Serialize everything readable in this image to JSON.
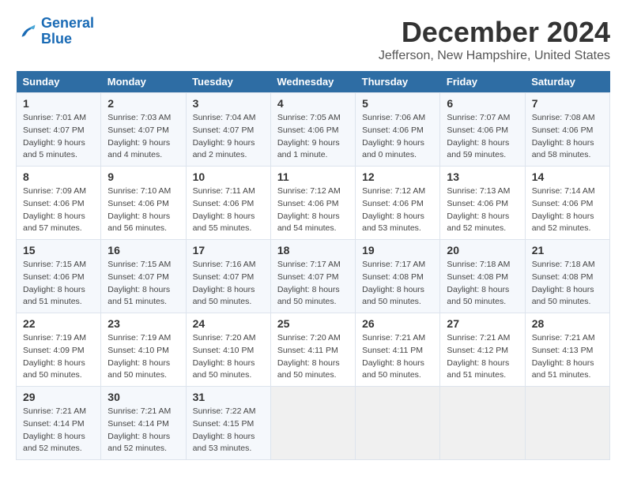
{
  "logo": {
    "line1": "General",
    "line2": "Blue"
  },
  "title": "December 2024",
  "location": "Jefferson, New Hampshire, United States",
  "days_of_week": [
    "Sunday",
    "Monday",
    "Tuesday",
    "Wednesday",
    "Thursday",
    "Friday",
    "Saturday"
  ],
  "weeks": [
    [
      {
        "day": "1",
        "info": "Sunrise: 7:01 AM\nSunset: 4:07 PM\nDaylight: 9 hours\nand 5 minutes."
      },
      {
        "day": "2",
        "info": "Sunrise: 7:03 AM\nSunset: 4:07 PM\nDaylight: 9 hours\nand 4 minutes."
      },
      {
        "day": "3",
        "info": "Sunrise: 7:04 AM\nSunset: 4:07 PM\nDaylight: 9 hours\nand 2 minutes."
      },
      {
        "day": "4",
        "info": "Sunrise: 7:05 AM\nSunset: 4:06 PM\nDaylight: 9 hours\nand 1 minute."
      },
      {
        "day": "5",
        "info": "Sunrise: 7:06 AM\nSunset: 4:06 PM\nDaylight: 9 hours\nand 0 minutes."
      },
      {
        "day": "6",
        "info": "Sunrise: 7:07 AM\nSunset: 4:06 PM\nDaylight: 8 hours\nand 59 minutes."
      },
      {
        "day": "7",
        "info": "Sunrise: 7:08 AM\nSunset: 4:06 PM\nDaylight: 8 hours\nand 58 minutes."
      }
    ],
    [
      {
        "day": "8",
        "info": "Sunrise: 7:09 AM\nSunset: 4:06 PM\nDaylight: 8 hours\nand 57 minutes."
      },
      {
        "day": "9",
        "info": "Sunrise: 7:10 AM\nSunset: 4:06 PM\nDaylight: 8 hours\nand 56 minutes."
      },
      {
        "day": "10",
        "info": "Sunrise: 7:11 AM\nSunset: 4:06 PM\nDaylight: 8 hours\nand 55 minutes."
      },
      {
        "day": "11",
        "info": "Sunrise: 7:12 AM\nSunset: 4:06 PM\nDaylight: 8 hours\nand 54 minutes."
      },
      {
        "day": "12",
        "info": "Sunrise: 7:12 AM\nSunset: 4:06 PM\nDaylight: 8 hours\nand 53 minutes."
      },
      {
        "day": "13",
        "info": "Sunrise: 7:13 AM\nSunset: 4:06 PM\nDaylight: 8 hours\nand 52 minutes."
      },
      {
        "day": "14",
        "info": "Sunrise: 7:14 AM\nSunset: 4:06 PM\nDaylight: 8 hours\nand 52 minutes."
      }
    ],
    [
      {
        "day": "15",
        "info": "Sunrise: 7:15 AM\nSunset: 4:06 PM\nDaylight: 8 hours\nand 51 minutes."
      },
      {
        "day": "16",
        "info": "Sunrise: 7:15 AM\nSunset: 4:07 PM\nDaylight: 8 hours\nand 51 minutes."
      },
      {
        "day": "17",
        "info": "Sunrise: 7:16 AM\nSunset: 4:07 PM\nDaylight: 8 hours\nand 50 minutes."
      },
      {
        "day": "18",
        "info": "Sunrise: 7:17 AM\nSunset: 4:07 PM\nDaylight: 8 hours\nand 50 minutes."
      },
      {
        "day": "19",
        "info": "Sunrise: 7:17 AM\nSunset: 4:08 PM\nDaylight: 8 hours\nand 50 minutes."
      },
      {
        "day": "20",
        "info": "Sunrise: 7:18 AM\nSunset: 4:08 PM\nDaylight: 8 hours\nand 50 minutes."
      },
      {
        "day": "21",
        "info": "Sunrise: 7:18 AM\nSunset: 4:08 PM\nDaylight: 8 hours\nand 50 minutes."
      }
    ],
    [
      {
        "day": "22",
        "info": "Sunrise: 7:19 AM\nSunset: 4:09 PM\nDaylight: 8 hours\nand 50 minutes."
      },
      {
        "day": "23",
        "info": "Sunrise: 7:19 AM\nSunset: 4:10 PM\nDaylight: 8 hours\nand 50 minutes."
      },
      {
        "day": "24",
        "info": "Sunrise: 7:20 AM\nSunset: 4:10 PM\nDaylight: 8 hours\nand 50 minutes."
      },
      {
        "day": "25",
        "info": "Sunrise: 7:20 AM\nSunset: 4:11 PM\nDaylight: 8 hours\nand 50 minutes."
      },
      {
        "day": "26",
        "info": "Sunrise: 7:21 AM\nSunset: 4:11 PM\nDaylight: 8 hours\nand 50 minutes."
      },
      {
        "day": "27",
        "info": "Sunrise: 7:21 AM\nSunset: 4:12 PM\nDaylight: 8 hours\nand 51 minutes."
      },
      {
        "day": "28",
        "info": "Sunrise: 7:21 AM\nSunset: 4:13 PM\nDaylight: 8 hours\nand 51 minutes."
      }
    ],
    [
      {
        "day": "29",
        "info": "Sunrise: 7:21 AM\nSunset: 4:14 PM\nDaylight: 8 hours\nand 52 minutes."
      },
      {
        "day": "30",
        "info": "Sunrise: 7:21 AM\nSunset: 4:14 PM\nDaylight: 8 hours\nand 52 minutes."
      },
      {
        "day": "31",
        "info": "Sunrise: 7:22 AM\nSunset: 4:15 PM\nDaylight: 8 hours\nand 53 minutes."
      },
      {
        "day": "",
        "info": ""
      },
      {
        "day": "",
        "info": ""
      },
      {
        "day": "",
        "info": ""
      },
      {
        "day": "",
        "info": ""
      }
    ]
  ]
}
